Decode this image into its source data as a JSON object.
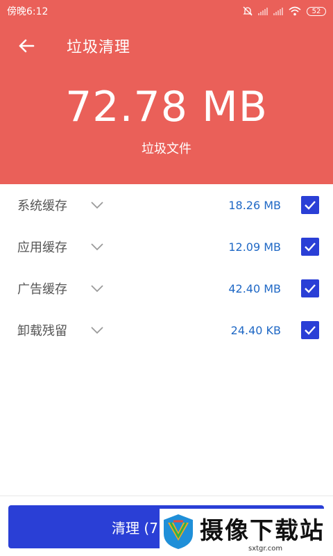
{
  "status_bar": {
    "time": "傍晚6:12",
    "battery": "52"
  },
  "header": {
    "title": "垃圾清理",
    "total_size": "72.78 MB",
    "caption": "垃圾文件"
  },
  "items": [
    {
      "label": "系统缓存",
      "size": "18.26 MB",
      "checked": true
    },
    {
      "label": "应用缓存",
      "size": "12.09 MB",
      "checked": true
    },
    {
      "label": "广告缓存",
      "size": "42.40 MB",
      "checked": true
    },
    {
      "label": "卸载残留",
      "size": "24.40 KB",
      "checked": true
    }
  ],
  "clean_button": {
    "label": "清理 (7"
  },
  "watermark": {
    "text": "摄像下载站",
    "domain": "sxtgr.com"
  },
  "colors": {
    "header_bg": "#ea6059",
    "accent_blue": "#2a3fd6",
    "size_text": "#1f68c5"
  }
}
